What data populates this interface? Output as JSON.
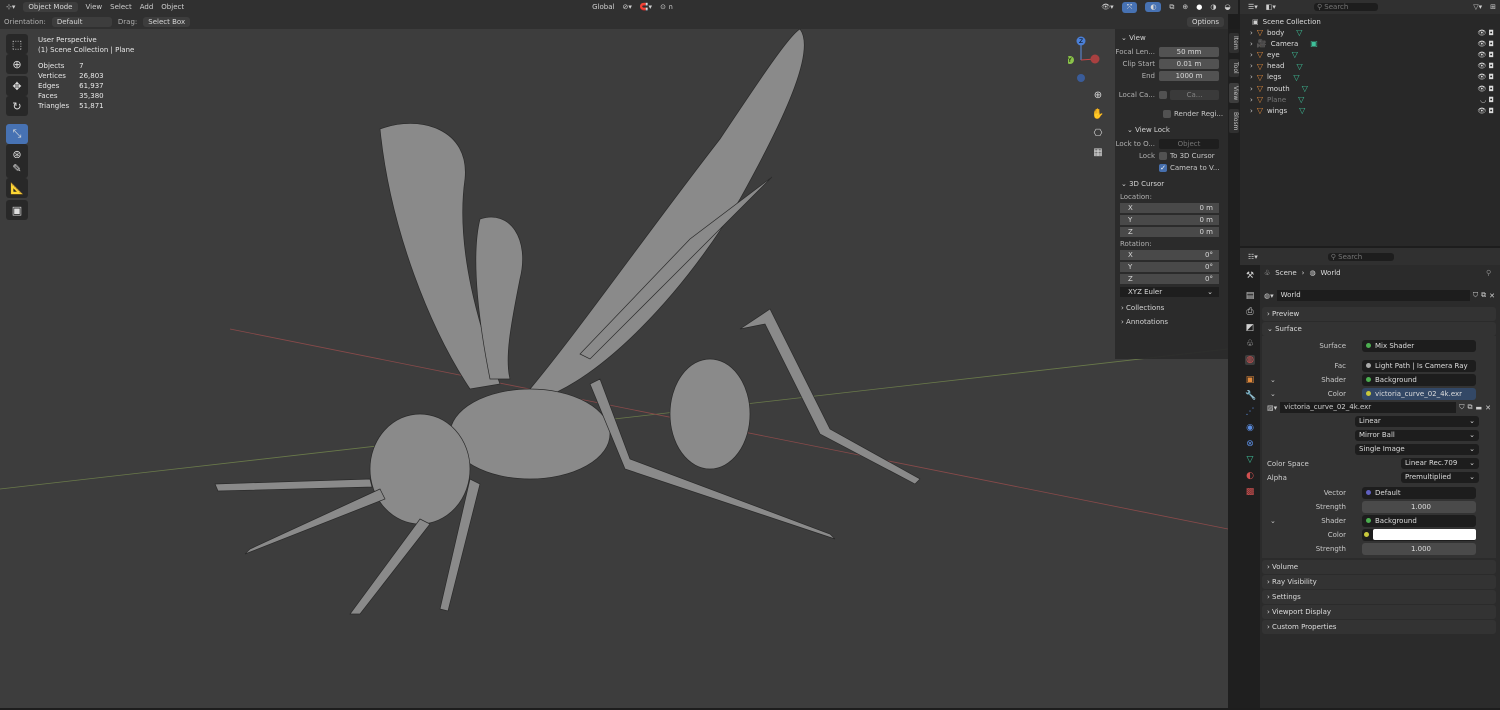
{
  "header": {
    "mode": "Object Mode",
    "menus": [
      "View",
      "Select",
      "Add",
      "Object"
    ],
    "transform_orientation": "Global"
  },
  "tool_settings": {
    "orientation_label": "Orientation:",
    "orientation_value": "Default",
    "drag_label": "Drag:",
    "drag_value": "Select Box",
    "options": "Options"
  },
  "viewport": {
    "perspective": "User Perspective",
    "collection": "(1) Scene Collection | Plane",
    "stats": [
      {
        "label": "Objects",
        "value": "7"
      },
      {
        "label": "Vertices",
        "value": "26,803"
      },
      {
        "label": "Edges",
        "value": "61,937"
      },
      {
        "label": "Faces",
        "value": "35,380"
      },
      {
        "label": "Triangles",
        "value": "51,871"
      }
    ],
    "gizmo": {
      "x": "X",
      "y": "Y",
      "z": "Z"
    }
  },
  "npanel": {
    "view_title": "View",
    "focal_label": "Focal Len...",
    "focal": "50 mm",
    "clip_start_label": "Clip Start",
    "clip_start": "0.01 m",
    "end_label": "End",
    "end": "1000 m",
    "local_cam_label": "Local Ca...",
    "local_cam": "Ca...",
    "render_region": "Render Regi...",
    "view_lock_title": "View Lock",
    "lock_to_label": "Lock to O...",
    "lock_to_placeholder": "Object",
    "lock_label": "Lock",
    "to_cursor": "To 3D Cursor",
    "camera_to_view": "Camera to V...",
    "cursor_title": "3D Cursor",
    "location_label": "Location:",
    "rotation_label": "Rotation:",
    "location": [
      {
        "axis": "X",
        "value": "0 m"
      },
      {
        "axis": "Y",
        "value": "0 m"
      },
      {
        "axis": "Z",
        "value": "0 m"
      }
    ],
    "rotation": [
      {
        "axis": "X",
        "value": "0°"
      },
      {
        "axis": "Y",
        "value": "0°"
      },
      {
        "axis": "Z",
        "value": "0°"
      }
    ],
    "rotation_mode": "XYZ Euler",
    "collections": "Collections",
    "annotations": "Annotations",
    "tabs": [
      "Item",
      "Tool",
      "View",
      "Blosm"
    ]
  },
  "outliner": {
    "search_placeholder": "Search",
    "root": "Scene Collection",
    "items": [
      {
        "name": "body"
      },
      {
        "name": "Camera"
      },
      {
        "name": "eye"
      },
      {
        "name": "head"
      },
      {
        "name": "legs"
      },
      {
        "name": "mouth"
      },
      {
        "name": "Plane"
      },
      {
        "name": "wings"
      }
    ]
  },
  "properties": {
    "search_placeholder": "Search",
    "breadcrumb": [
      "Scene",
      "World"
    ],
    "world_name": "World",
    "panels": {
      "preview": "Preview",
      "surface": "Surface",
      "volume": "Volume",
      "ray_visibility": "Ray Visibility",
      "settings": "Settings",
      "viewport_display": "Viewport Display",
      "custom_properties": "Custom Properties"
    },
    "surface": {
      "surface_label": "Surface",
      "surface_value": "Mix Shader",
      "fac_label": "Fac",
      "fac_value": "Light Path | Is Camera Ray",
      "shader1_label": "Shader",
      "shader1_value": "Background",
      "color1_label": "Color",
      "color1_value": "victoria_curve_02_4k.exr",
      "image_name": "victoria_curve_02_4k.exr",
      "interpolation": "Linear",
      "projection": "Mirror Ball",
      "source": "Single Image",
      "color_space_label": "Color Space",
      "color_space": "Linear Rec.709",
      "alpha_label": "Alpha",
      "alpha": "Premultiplied",
      "vector_label": "Vector",
      "vector_value": "Default",
      "strength1_label": "Strength",
      "strength1": "1.000",
      "shader2_label": "Shader",
      "shader2_value": "Background",
      "color2_label": "Color",
      "color2": "#ffffff",
      "strength2_label": "Strength",
      "strength2": "1.000"
    }
  },
  "colors": {
    "accent": "#4772b3",
    "mesh_orange": "#e08a3c",
    "data_green": "#3ec19a",
    "viewport_bg": "#3d3d3d"
  }
}
